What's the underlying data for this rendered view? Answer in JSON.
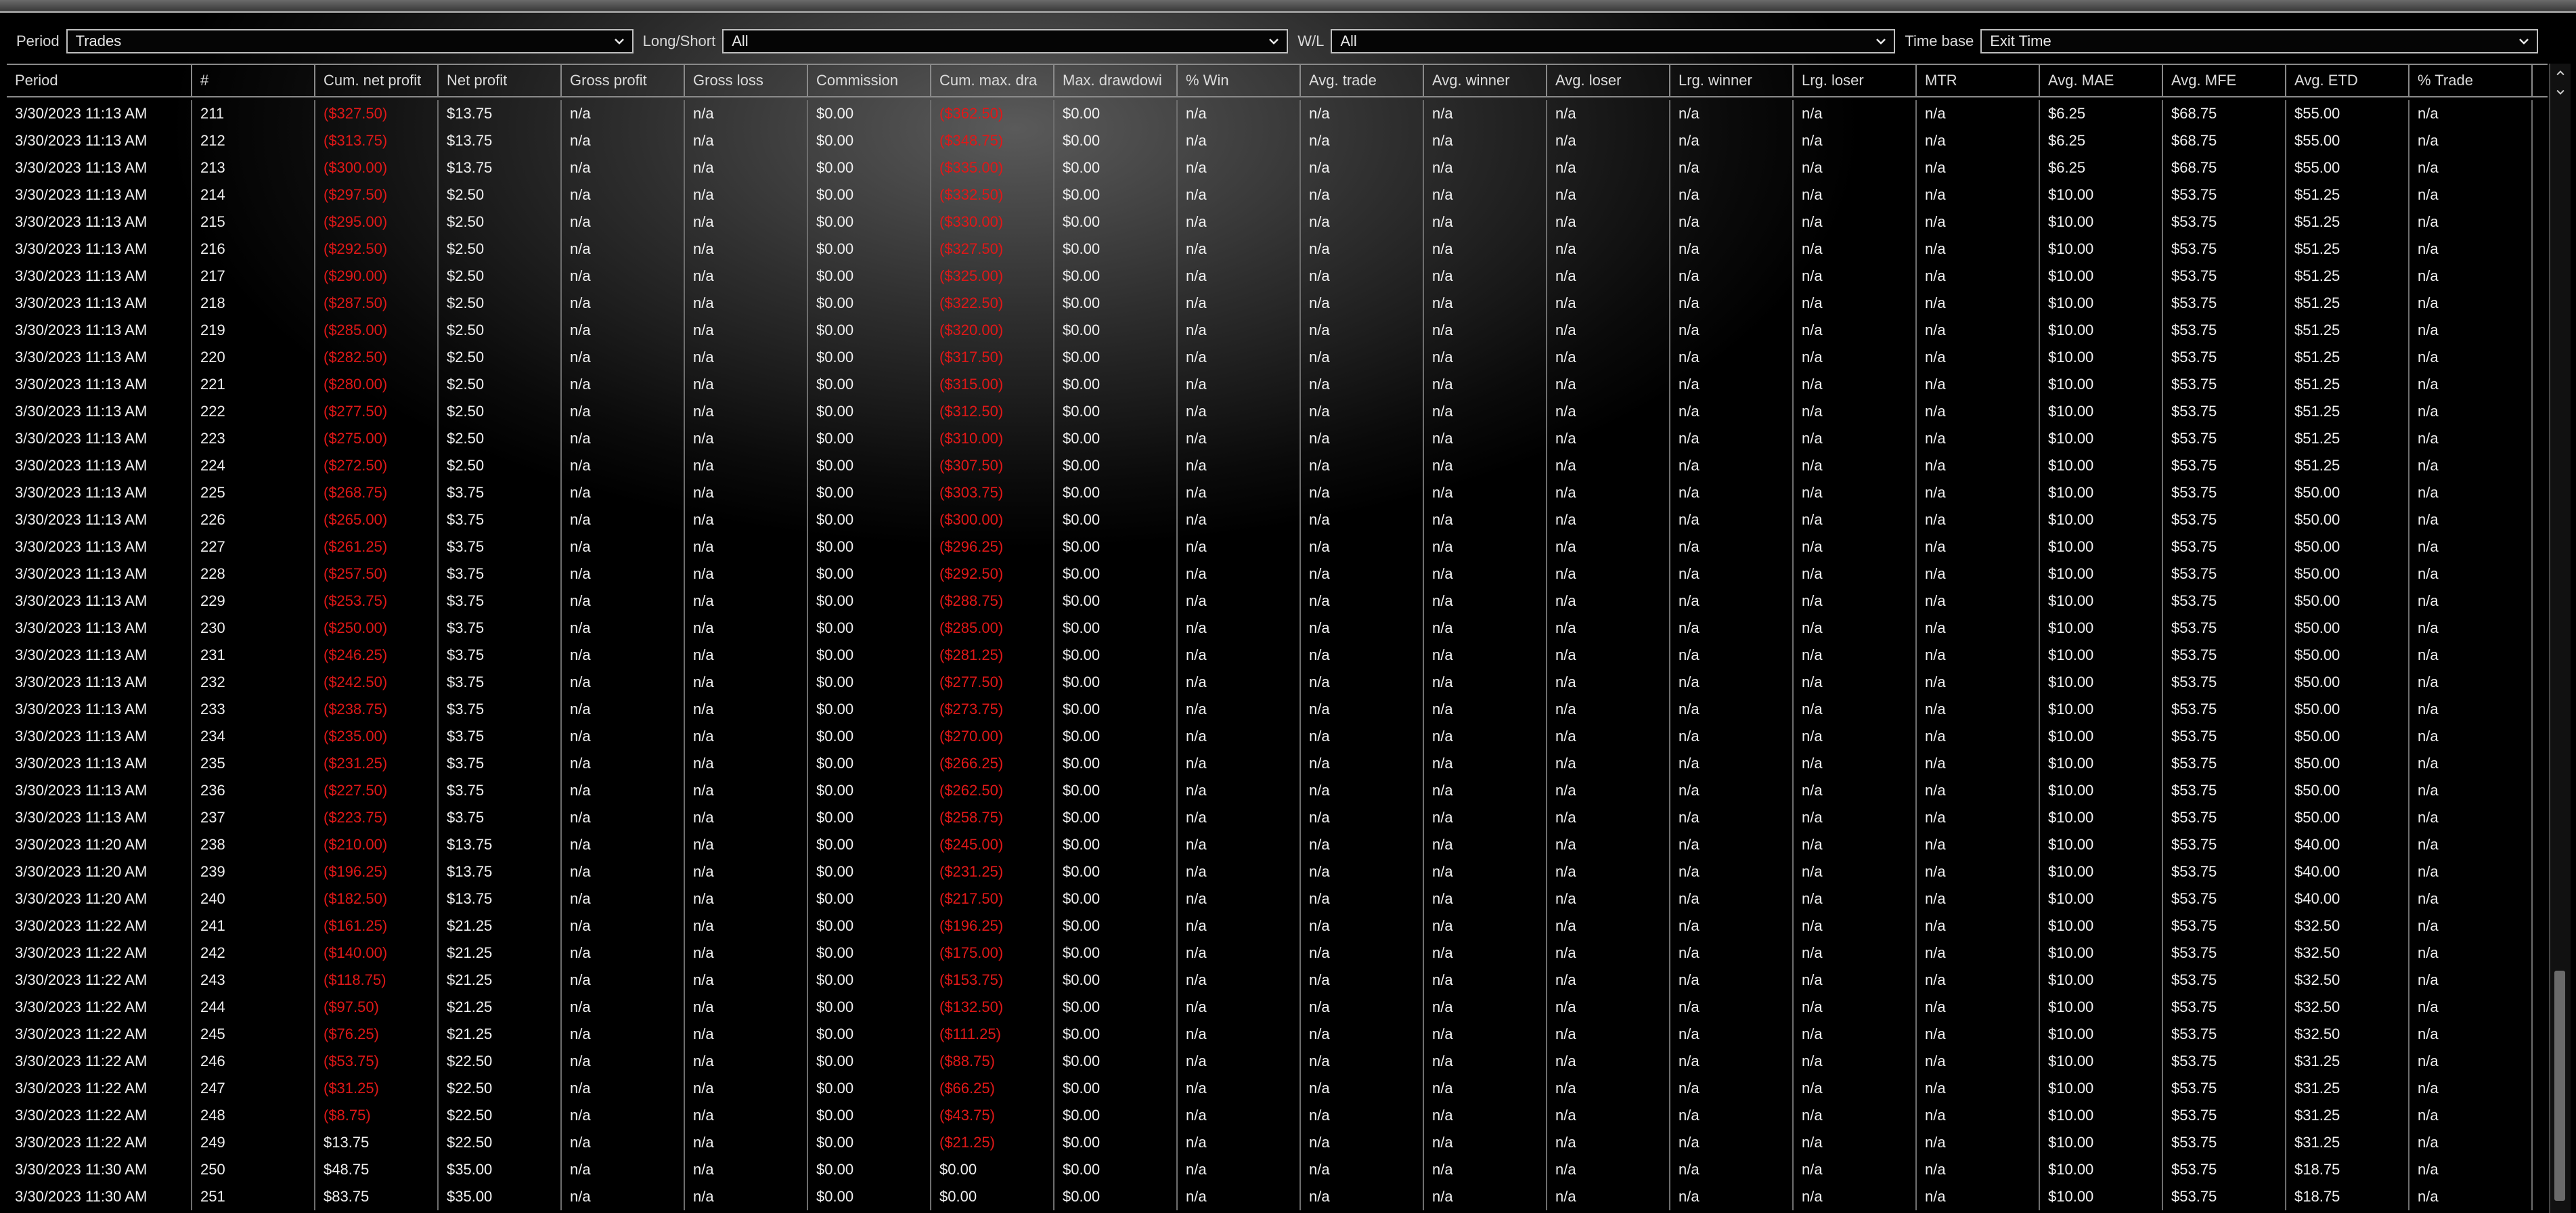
{
  "filters": {
    "period": {
      "label": "Period",
      "value": "Trades"
    },
    "long_short": {
      "label": "Long/Short",
      "value": "All"
    },
    "wl": {
      "label": "W/L",
      "value": "All"
    },
    "time_base": {
      "label": "Time base",
      "value": "Exit Time"
    }
  },
  "columns": [
    "Period",
    "#",
    "Cum. net profit",
    "Net profit",
    "Gross profit",
    "Gross loss",
    "Commission",
    "Cum. max. dra",
    "Max. drawdowi",
    "% Win",
    "Avg. trade",
    "Avg. winner",
    "Avg. loser",
    "Lrg. winner",
    "Lrg. loser",
    "MTR",
    "Avg. MAE",
    "Avg. MFE",
    "Avg. ETD",
    "% Trade"
  ],
  "rows": [
    [
      "3/30/2023 11:13 AM",
      "211",
      "($327.50)",
      "$13.75",
      "($362.50)",
      "$6.25",
      "$68.75",
      "$55.00"
    ],
    [
      "3/30/2023 11:13 AM",
      "212",
      "($313.75)",
      "$13.75",
      "($348.75)",
      "$6.25",
      "$68.75",
      "$55.00"
    ],
    [
      "3/30/2023 11:13 AM",
      "213",
      "($300.00)",
      "$13.75",
      "($335.00)",
      "$6.25",
      "$68.75",
      "$55.00"
    ],
    [
      "3/30/2023 11:13 AM",
      "214",
      "($297.50)",
      "$2.50",
      "($332.50)",
      "$10.00",
      "$53.75",
      "$51.25"
    ],
    [
      "3/30/2023 11:13 AM",
      "215",
      "($295.00)",
      "$2.50",
      "($330.00)",
      "$10.00",
      "$53.75",
      "$51.25"
    ],
    [
      "3/30/2023 11:13 AM",
      "216",
      "($292.50)",
      "$2.50",
      "($327.50)",
      "$10.00",
      "$53.75",
      "$51.25"
    ],
    [
      "3/30/2023 11:13 AM",
      "217",
      "($290.00)",
      "$2.50",
      "($325.00)",
      "$10.00",
      "$53.75",
      "$51.25"
    ],
    [
      "3/30/2023 11:13 AM",
      "218",
      "($287.50)",
      "$2.50",
      "($322.50)",
      "$10.00",
      "$53.75",
      "$51.25"
    ],
    [
      "3/30/2023 11:13 AM",
      "219",
      "($285.00)",
      "$2.50",
      "($320.00)",
      "$10.00",
      "$53.75",
      "$51.25"
    ],
    [
      "3/30/2023 11:13 AM",
      "220",
      "($282.50)",
      "$2.50",
      "($317.50)",
      "$10.00",
      "$53.75",
      "$51.25"
    ],
    [
      "3/30/2023 11:13 AM",
      "221",
      "($280.00)",
      "$2.50",
      "($315.00)",
      "$10.00",
      "$53.75",
      "$51.25"
    ],
    [
      "3/30/2023 11:13 AM",
      "222",
      "($277.50)",
      "$2.50",
      "($312.50)",
      "$10.00",
      "$53.75",
      "$51.25"
    ],
    [
      "3/30/2023 11:13 AM",
      "223",
      "($275.00)",
      "$2.50",
      "($310.00)",
      "$10.00",
      "$53.75",
      "$51.25"
    ],
    [
      "3/30/2023 11:13 AM",
      "224",
      "($272.50)",
      "$2.50",
      "($307.50)",
      "$10.00",
      "$53.75",
      "$51.25"
    ],
    [
      "3/30/2023 11:13 AM",
      "225",
      "($268.75)",
      "$3.75",
      "($303.75)",
      "$10.00",
      "$53.75",
      "$50.00"
    ],
    [
      "3/30/2023 11:13 AM",
      "226",
      "($265.00)",
      "$3.75",
      "($300.00)",
      "$10.00",
      "$53.75",
      "$50.00"
    ],
    [
      "3/30/2023 11:13 AM",
      "227",
      "($261.25)",
      "$3.75",
      "($296.25)",
      "$10.00",
      "$53.75",
      "$50.00"
    ],
    [
      "3/30/2023 11:13 AM",
      "228",
      "($257.50)",
      "$3.75",
      "($292.50)",
      "$10.00",
      "$53.75",
      "$50.00"
    ],
    [
      "3/30/2023 11:13 AM",
      "229",
      "($253.75)",
      "$3.75",
      "($288.75)",
      "$10.00",
      "$53.75",
      "$50.00"
    ],
    [
      "3/30/2023 11:13 AM",
      "230",
      "($250.00)",
      "$3.75",
      "($285.00)",
      "$10.00",
      "$53.75",
      "$50.00"
    ],
    [
      "3/30/2023 11:13 AM",
      "231",
      "($246.25)",
      "$3.75",
      "($281.25)",
      "$10.00",
      "$53.75",
      "$50.00"
    ],
    [
      "3/30/2023 11:13 AM",
      "232",
      "($242.50)",
      "$3.75",
      "($277.50)",
      "$10.00",
      "$53.75",
      "$50.00"
    ],
    [
      "3/30/2023 11:13 AM",
      "233",
      "($238.75)",
      "$3.75",
      "($273.75)",
      "$10.00",
      "$53.75",
      "$50.00"
    ],
    [
      "3/30/2023 11:13 AM",
      "234",
      "($235.00)",
      "$3.75",
      "($270.00)",
      "$10.00",
      "$53.75",
      "$50.00"
    ],
    [
      "3/30/2023 11:13 AM",
      "235",
      "($231.25)",
      "$3.75",
      "($266.25)",
      "$10.00",
      "$53.75",
      "$50.00"
    ],
    [
      "3/30/2023 11:13 AM",
      "236",
      "($227.50)",
      "$3.75",
      "($262.50)",
      "$10.00",
      "$53.75",
      "$50.00"
    ],
    [
      "3/30/2023 11:13 AM",
      "237",
      "($223.75)",
      "$3.75",
      "($258.75)",
      "$10.00",
      "$53.75",
      "$50.00"
    ],
    [
      "3/30/2023 11:20 AM",
      "238",
      "($210.00)",
      "$13.75",
      "($245.00)",
      "$10.00",
      "$53.75",
      "$40.00"
    ],
    [
      "3/30/2023 11:20 AM",
      "239",
      "($196.25)",
      "$13.75",
      "($231.25)",
      "$10.00",
      "$53.75",
      "$40.00"
    ],
    [
      "3/30/2023 11:20 AM",
      "240",
      "($182.50)",
      "$13.75",
      "($217.50)",
      "$10.00",
      "$53.75",
      "$40.00"
    ],
    [
      "3/30/2023 11:22 AM",
      "241",
      "($161.25)",
      "$21.25",
      "($196.25)",
      "$10.00",
      "$53.75",
      "$32.50"
    ],
    [
      "3/30/2023 11:22 AM",
      "242",
      "($140.00)",
      "$21.25",
      "($175.00)",
      "$10.00",
      "$53.75",
      "$32.50"
    ],
    [
      "3/30/2023 11:22 AM",
      "243",
      "($118.75)",
      "$21.25",
      "($153.75)",
      "$10.00",
      "$53.75",
      "$32.50"
    ],
    [
      "3/30/2023 11:22 AM",
      "244",
      "($97.50)",
      "$21.25",
      "($132.50)",
      "$10.00",
      "$53.75",
      "$32.50"
    ],
    [
      "3/30/2023 11:22 AM",
      "245",
      "($76.25)",
      "$21.25",
      "($111.25)",
      "$10.00",
      "$53.75",
      "$32.50"
    ],
    [
      "3/30/2023 11:22 AM",
      "246",
      "($53.75)",
      "$22.50",
      "($88.75)",
      "$10.00",
      "$53.75",
      "$31.25"
    ],
    [
      "3/30/2023 11:22 AM",
      "247",
      "($31.25)",
      "$22.50",
      "($66.25)",
      "$10.00",
      "$53.75",
      "$31.25"
    ],
    [
      "3/30/2023 11:22 AM",
      "248",
      "($8.75)",
      "$22.50",
      "($43.75)",
      "$10.00",
      "$53.75",
      "$31.25"
    ],
    [
      "3/30/2023 11:22 AM",
      "249",
      "$13.75",
      "$22.50",
      "($21.25)",
      "$10.00",
      "$53.75",
      "$31.25"
    ],
    [
      "3/30/2023 11:30 AM",
      "250",
      "$48.75",
      "$35.00",
      "$0.00",
      "$10.00",
      "$53.75",
      "$18.75"
    ],
    [
      "3/30/2023 11:30 AM",
      "251",
      "$83.75",
      "$35.00",
      "$0.00",
      "$10.00",
      "$53.75",
      "$18.75"
    ]
  ],
  "constants": {
    "na": "n/a",
    "zero": "$0.00"
  },
  "colors": {
    "negative": "#e01818",
    "text": "#f0f0f0",
    "background": "#000000"
  },
  "icons": {
    "dropdown": "chevron-down-icon",
    "scroll_up": "arrow-up-icon",
    "scroll_down": "arrow-down-icon"
  }
}
